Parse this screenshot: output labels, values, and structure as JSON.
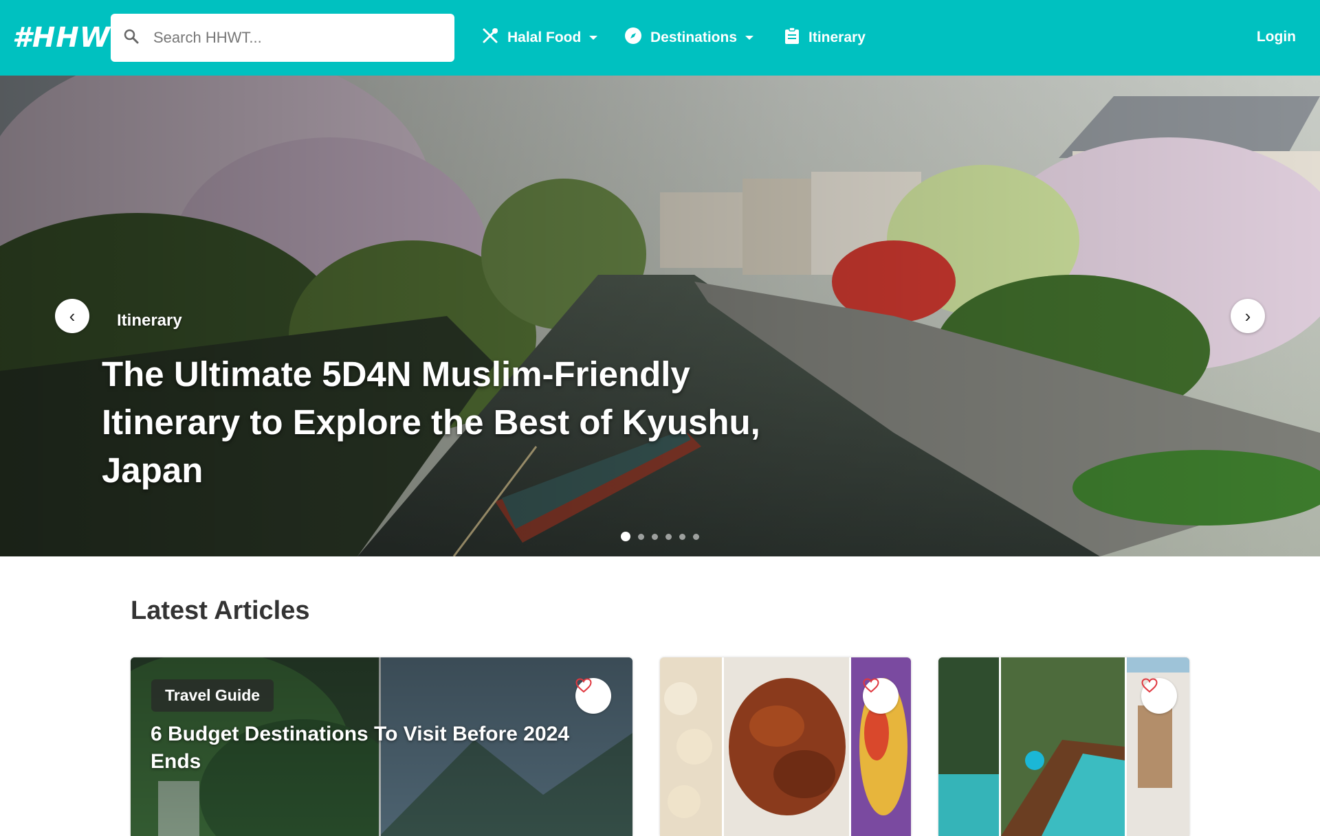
{
  "header": {
    "logo": "#HHWT",
    "search_placeholder": "Search HHWT...",
    "nav": [
      {
        "label": "Halal Food",
        "icon": "utensils-icon",
        "dropdown": true
      },
      {
        "label": "Destinations",
        "icon": "compass-icon",
        "dropdown": true
      },
      {
        "label": "Itinerary",
        "icon": "clipboard-icon",
        "dropdown": false
      }
    ],
    "login": "Login",
    "bg_color": "#00c1c0"
  },
  "hero": {
    "category": "Itinerary",
    "title": "The Ultimate 5D4N Muslim-Friendly Itinerary to Explore the Best of Kyushu, Japan",
    "slide_count": 6,
    "active_slide": 1
  },
  "latest": {
    "title": "Latest Articles",
    "cards": [
      {
        "badge": "Travel Guide",
        "title": "6 Budget Destinations To Visit Before 2024 Ends"
      },
      {
        "badge": "",
        "title": ""
      },
      {
        "badge": "",
        "title": ""
      }
    ]
  }
}
